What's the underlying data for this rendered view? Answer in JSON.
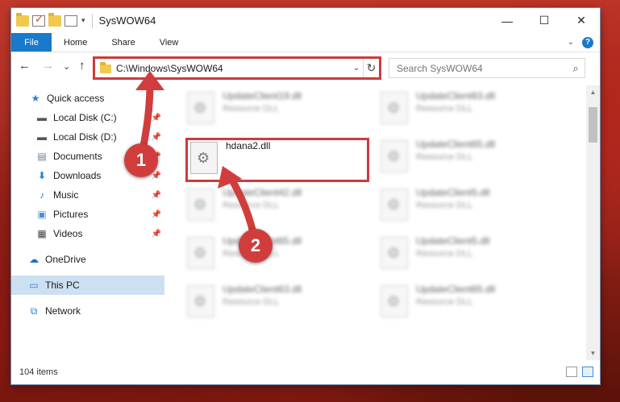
{
  "window": {
    "title": "SysWOW64",
    "controls": {
      "minimize": "—",
      "maximize": "☐",
      "close": "✕"
    }
  },
  "ribbon": {
    "tabs": [
      "File",
      "Home",
      "Share",
      "View"
    ],
    "expand_glyph": "⌄",
    "help_glyph": "?"
  },
  "navbar": {
    "back": "←",
    "forward": "→",
    "recent": "⌄",
    "up": "↑",
    "address": "C:\\Windows\\SysWOW64",
    "search_placeholder": "Search SysWOW64"
  },
  "sidebar": {
    "items": [
      {
        "label": "Quick access",
        "icon": "star-icon",
        "pinned": false
      },
      {
        "label": "Local Disk (C:)",
        "icon": "drive-icon",
        "pinned": true
      },
      {
        "label": "Local Disk (D:)",
        "icon": "drive-icon",
        "pinned": true
      },
      {
        "label": "Documents",
        "icon": "document-icon",
        "pinned": true
      },
      {
        "label": "Downloads",
        "icon": "download-icon",
        "pinned": true
      },
      {
        "label": "Music",
        "icon": "music-icon",
        "pinned": true
      },
      {
        "label": "Pictures",
        "icon": "pictures-icon",
        "pinned": true
      },
      {
        "label": "Videos",
        "icon": "video-icon",
        "pinned": true
      },
      {
        "label": "OneDrive",
        "icon": "cloud-icon",
        "pinned": false
      },
      {
        "label": "This PC",
        "icon": "computer-icon",
        "pinned": false,
        "selected": true
      },
      {
        "label": "Network",
        "icon": "network-icon",
        "pinned": false
      }
    ]
  },
  "files": [
    {
      "name": "UpdateClient19.dll",
      "type": "Resource DLL",
      "blurred": true
    },
    {
      "name": "UpdateClient63.dll",
      "type": "Resource DLL",
      "blurred": true
    },
    {
      "name": "hdana2.dll",
      "type": "",
      "blurred": false,
      "highlighted": true
    },
    {
      "name": "UpdateClient65.dll",
      "type": "Resource DLL",
      "blurred": true
    },
    {
      "name": "UpdateClient42.dll",
      "type": "Resource DLL",
      "blurred": true
    },
    {
      "name": "UpdateClient5.dll",
      "type": "Resource DLL",
      "blurred": true
    },
    {
      "name": "UpdateClient65.dll",
      "type": "Resource DLL",
      "blurred": true
    },
    {
      "name": "UpdateClient5.dll",
      "type": "Resource DLL",
      "blurred": true
    },
    {
      "name": "UpdateClient63.dll",
      "type": "Resource DLL",
      "blurred": true
    },
    {
      "name": "UpdateClient65.dll",
      "type": "Resource DLL",
      "blurred": true
    }
  ],
  "status": {
    "item_count": "104 items"
  },
  "annotations": {
    "step1": "1",
    "step2": "2",
    "color": "#d13d3d"
  }
}
